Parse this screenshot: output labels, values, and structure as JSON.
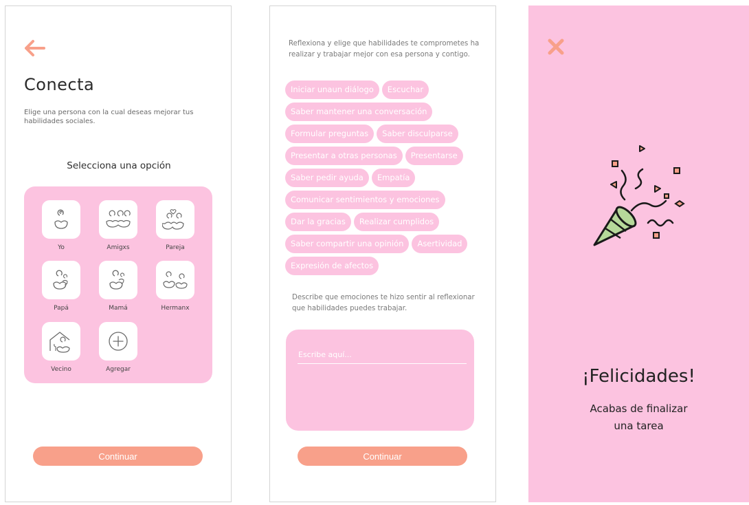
{
  "screen1": {
    "title": "Conecta",
    "description": "Elige una persona con la cual deseas mejorar tus habilidades sociales.",
    "select_label": "Selecciona una opción",
    "options": [
      {
        "label": "Yo",
        "icon": "single-person-icon"
      },
      {
        "label": "Amigxs",
        "icon": "friends-icon"
      },
      {
        "label": "Pareja",
        "icon": "couple-heart-icon"
      },
      {
        "label": "Papá",
        "icon": "dad-icon"
      },
      {
        "label": "Mamá",
        "icon": "mom-icon"
      },
      {
        "label": "Hermanx",
        "icon": "siblings-icon"
      },
      {
        "label": "Vecino",
        "icon": "neighbor-house-icon"
      },
      {
        "label": "Agregar",
        "icon": "add-circle-icon"
      }
    ],
    "continue_label": "Continuar"
  },
  "screen2": {
    "intro": "Reflexiona y elige que habilidades te comprometes ha realizar y trabajar mejor con esa persona y contigo.",
    "skills": [
      "Iniciar unaun diálogo",
      "Escuchar",
      "Saber mantener una conversación",
      "Formular preguntas",
      "Saber disculparse",
      "Presentar a otras personas",
      "Presentarse",
      "Saber pedir ayuda",
      "Empatía",
      "Comunicar sentimientos y emociones",
      "Dar la gracias",
      "Realizar cumplidos",
      "Saber compartir una opinión",
      "Asertividad",
      "Expresión de afectos"
    ],
    "describe_prompt": "Describe que emociones te hizo sentir al reflexionar que habilidades puedes trabajar.",
    "input_placeholder": "Escribe aquí...",
    "continue_label": "Continuar"
  },
  "screen3": {
    "title": "¡Felicidades!",
    "subtitle_line1": "Acabas de finalizar",
    "subtitle_line2": "una tarea"
  },
  "colors": {
    "accent": "#f8a08a",
    "pink": "#fcc3e0",
    "party_green": "#b6d89a"
  }
}
